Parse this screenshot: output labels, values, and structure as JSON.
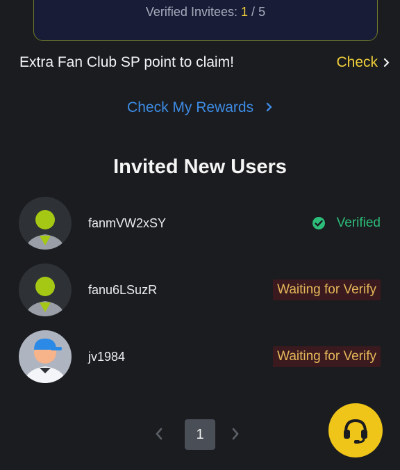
{
  "summary": {
    "label": "Verified Invitees:",
    "verified_count": "1",
    "separator": "/",
    "total": "5"
  },
  "claim": {
    "text": "Extra Fan Club SP point to claim!",
    "check_label": "Check"
  },
  "rewards_link_label": "Check My Rewards",
  "section_title": "Invited New Users",
  "users": [
    {
      "name": "fanmVW2xSY",
      "status": "Verified",
      "status_type": "verified",
      "avatar": "default-user-icon"
    },
    {
      "name": "fanu6LSuzR",
      "status": "Waiting for Verify",
      "status_type": "waiting",
      "avatar": "default-user-icon"
    },
    {
      "name": "jv1984",
      "status": "Waiting for Verify",
      "status_type": "waiting",
      "avatar": "cap-user-avatar"
    }
  ],
  "pagination": {
    "current_page": "1"
  },
  "colors": {
    "accent_yellow": "#f0d03a",
    "link_blue": "#3d8ce5",
    "verified_green": "#2cbd7a",
    "waiting_text": "#e6b85a",
    "waiting_bg": "#3a1a1e",
    "support_button": "#f0c519"
  },
  "icons": {
    "check_chevron": "chevron-right-icon",
    "verified": "check-circle-icon",
    "support": "headset-icon"
  }
}
